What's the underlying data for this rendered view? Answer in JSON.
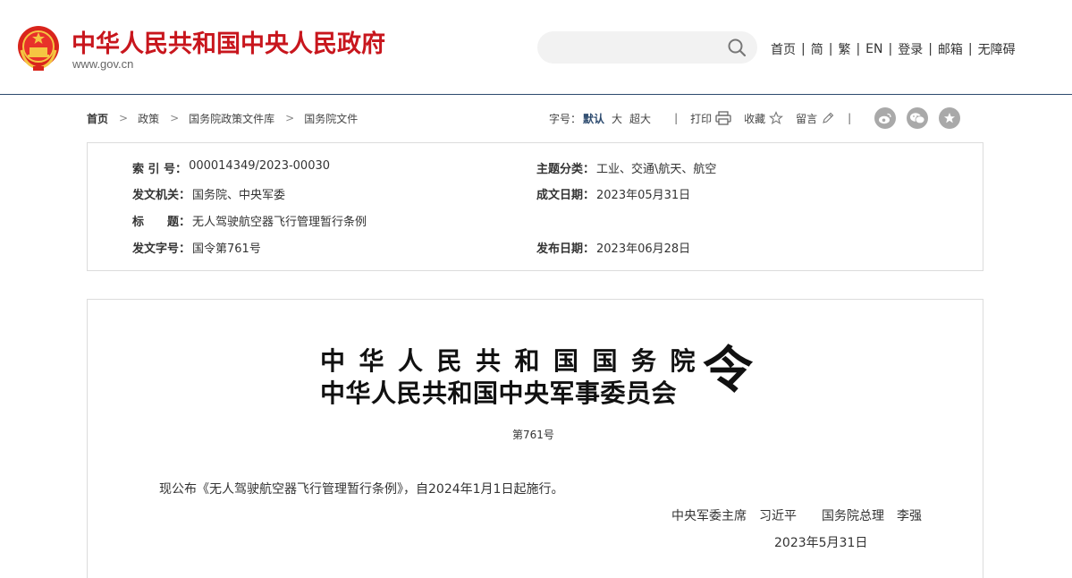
{
  "header": {
    "site_name": "中华人民共和国中央人民政府",
    "site_url": "www.gov.cn",
    "search": {
      "placeholder": ""
    },
    "nav": [
      "首页",
      "简",
      "繁",
      "EN",
      "登录",
      "邮箱",
      "无障碍"
    ]
  },
  "breadcrumb": [
    "首页",
    "政策",
    "国务院政策文件库",
    "国务院文件"
  ],
  "tools": {
    "font_size_label": "字号：",
    "font_sizes": [
      "默认",
      "大",
      "超大"
    ],
    "print": "打印",
    "favorite": "收藏",
    "comment": "留言"
  },
  "share": [
    "weibo-icon",
    "wechat-icon",
    "favorite-star-icon"
  ],
  "meta": {
    "index_no": {
      "label": "索 引 号：",
      "value": "000014349/2023-00030"
    },
    "category": {
      "label": "主题分类：",
      "value": "工业、交通\\航天、航空"
    },
    "issuer": {
      "label": "发文机关：",
      "value": "国务院、中央军委"
    },
    "written_date": {
      "label": "成文日期：",
      "value": "2023年05月31日"
    },
    "title": {
      "label": "标　　题：",
      "value": "无人驾驶航空器飞行管理暂行条例"
    },
    "doc_no": {
      "label": "发文字号：",
      "value": "国令第761号"
    },
    "publish_date": {
      "label": "发布日期：",
      "value": "2023年06月28日"
    }
  },
  "decree": {
    "line1": "中华人民共和国国务院",
    "line2": "中华人民共和国中央军事委员会",
    "suffix": "令",
    "number": "第761号",
    "body": "现公布《无人驾驶航空器飞行管理暂行条例》，自2024年1月1日起施行。",
    "signers": "中央军委主席　习近平　　国务院总理　李强",
    "date": "2023年5月31日"
  },
  "colors": {
    "brand_red": "#c8161d",
    "header_line": "#2c4a6e",
    "share_gray": "#a9a9a9"
  }
}
